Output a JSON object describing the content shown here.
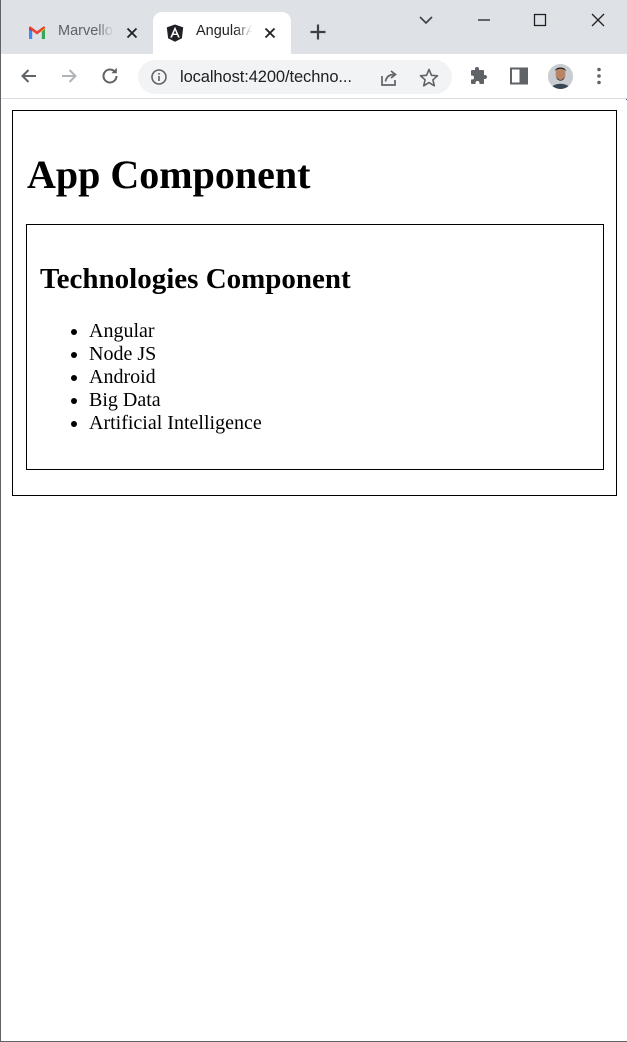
{
  "browser": {
    "tabs": [
      {
        "title": "Marvellous",
        "icon": "gmail-icon",
        "active": false
      },
      {
        "title": "AngularApp",
        "icon": "angular-icon",
        "active": true
      }
    ],
    "address_bar": {
      "url": "localhost:4200/techno..."
    }
  },
  "page": {
    "app_title": "App Component",
    "technologies": {
      "title": "Technologies Component",
      "items": [
        "Angular",
        "Node JS",
        "Android",
        "Big Data",
        "Artificial Intelligence"
      ]
    }
  },
  "colors": {
    "tabstrip_bg": "#dee1e6",
    "toolbar_bg": "#ffffff",
    "omnibox_bg": "#f1f3f4",
    "icon_color": "#5f6368"
  }
}
